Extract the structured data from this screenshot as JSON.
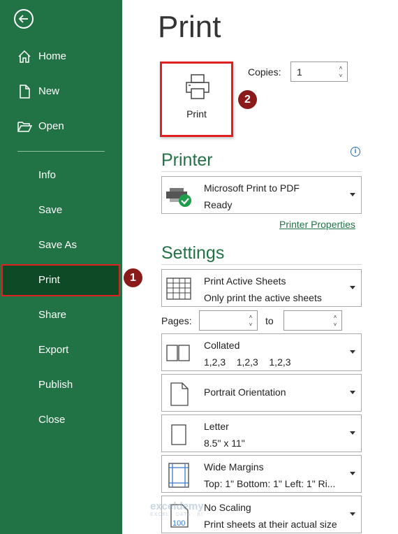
{
  "sidebar": {
    "items": [
      {
        "label": "Home",
        "icon": "home-icon"
      },
      {
        "label": "New",
        "icon": "new-document-icon"
      },
      {
        "label": "Open",
        "icon": "folder-open-icon"
      },
      {
        "label": "Info"
      },
      {
        "label": "Save"
      },
      {
        "label": "Save As"
      },
      {
        "label": "Print",
        "active": true
      },
      {
        "label": "Share"
      },
      {
        "label": "Export"
      },
      {
        "label": "Publish"
      },
      {
        "label": "Close"
      }
    ]
  },
  "main": {
    "title": "Print",
    "print_button_label": "Print",
    "copies_label": "Copies:",
    "copies_value": "1",
    "printer": {
      "section_title": "Printer",
      "name": "Microsoft Print to PDF",
      "status": "Ready",
      "properties_link": "Printer Properties"
    },
    "settings": {
      "section_title": "Settings",
      "sheets": {
        "title": "Print Active Sheets",
        "subtitle": "Only print the active sheets"
      },
      "pages_label": "Pages:",
      "to_label": "to",
      "collation": {
        "title": "Collated",
        "subtitle": "1,2,3    1,2,3    1,2,3"
      },
      "orientation": {
        "title": "Portrait Orientation"
      },
      "paper": {
        "title": "Letter",
        "subtitle": "8.5\" x 11\""
      },
      "margins": {
        "title": "Wide Margins",
        "subtitle": "Top: 1\" Bottom: 1\" Left: 1\" Ri..."
      },
      "scaling": {
        "title": "No Scaling",
        "subtitle": "Print sheets at their actual size"
      }
    }
  },
  "annotations": {
    "badge_1": "1",
    "badge_2": "2"
  },
  "watermark": {
    "name": "exceldemy",
    "tagline": "EXCEL · DATA · BI"
  },
  "colors": {
    "sidebar": "#217346",
    "active_item": "#0e4a25",
    "highlight": "#e02020",
    "badge": "#8b1a1a",
    "accent": "#217346"
  }
}
